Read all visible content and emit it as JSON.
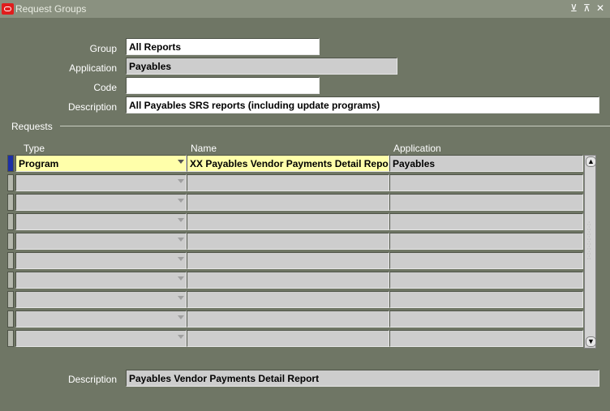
{
  "window": {
    "title": "Request Groups",
    "controls": [
      "⊻",
      "⊼",
      "✕"
    ]
  },
  "form": {
    "group": {
      "label": "Group",
      "value": "All Reports"
    },
    "application": {
      "label": "Application",
      "value": "Payables"
    },
    "code": {
      "label": "Code",
      "value": ""
    },
    "description": {
      "label": "Description",
      "value": "All Payables SRS reports (including update programs)"
    }
  },
  "requests": {
    "section_label": "Requests",
    "columns": {
      "type": "Type",
      "name": "Name",
      "application": "Application"
    },
    "rows": [
      {
        "type": "Program",
        "name": "XX Payables Vendor Payments Detail Report",
        "application": "Payables"
      },
      {
        "type": "",
        "name": "",
        "application": ""
      },
      {
        "type": "",
        "name": "",
        "application": ""
      },
      {
        "type": "",
        "name": "",
        "application": ""
      },
      {
        "type": "",
        "name": "",
        "application": ""
      },
      {
        "type": "",
        "name": "",
        "application": ""
      },
      {
        "type": "",
        "name": "",
        "application": ""
      },
      {
        "type": "",
        "name": "",
        "application": ""
      },
      {
        "type": "",
        "name": "",
        "application": ""
      },
      {
        "type": "",
        "name": "",
        "application": ""
      }
    ]
  },
  "footer": {
    "description": {
      "label": "Description",
      "value": "Payables Vendor Payments Detail Report"
    }
  },
  "colors": {
    "background": "#6f7665",
    "active_field": "#ffffaa",
    "record_indicator": "#1d2fa6"
  }
}
